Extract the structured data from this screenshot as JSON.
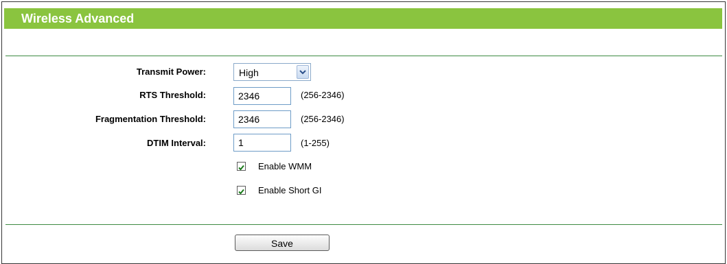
{
  "header": {
    "title": "Wireless Advanced"
  },
  "form": {
    "transmit_power": {
      "label": "Transmit Power:",
      "value": "High"
    },
    "rts_threshold": {
      "label": "RTS Threshold:",
      "value": "2346",
      "hint": "(256-2346)"
    },
    "fragmentation_threshold": {
      "label": "Fragmentation Threshold:",
      "value": "2346",
      "hint": "(256-2346)"
    },
    "dtim_interval": {
      "label": "DTIM Interval:",
      "value": "1",
      "hint": "(1-255)"
    },
    "enable_wmm": {
      "label": "Enable WMM",
      "checked": true
    },
    "enable_short_gi": {
      "label": "Enable Short GI",
      "checked": true
    }
  },
  "actions": {
    "save_label": "Save"
  },
  "colors": {
    "title_bar": "#8ac43f",
    "divider": "#3c8a41",
    "input_border": "#6d9cc7"
  }
}
